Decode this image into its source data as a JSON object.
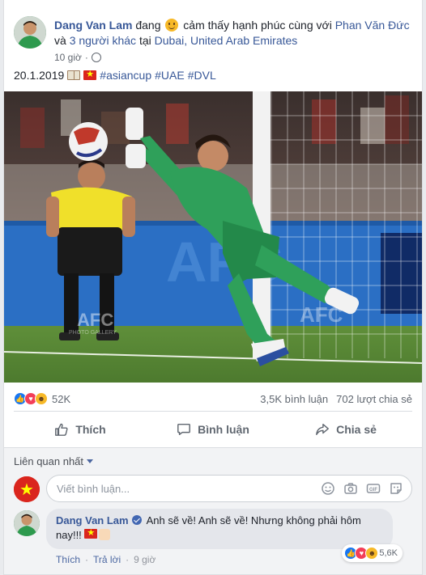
{
  "post": {
    "author": "Dang Van Lam",
    "feeling_prefix": "đang",
    "feeling_text": "cảm thấy hạnh phúc cùng với",
    "tagged_friend": "Phan Văn Đức",
    "and_text": "và",
    "others_link": "3 người khác",
    "at_text": "tại",
    "location": "Dubai, United Arab Emirates",
    "time": "10 giờ",
    "caption_date": "20.1.2019",
    "hashtags": [
      "#asiancup",
      "#UAE",
      "#DVL"
    ],
    "photo_watermark": "AFC",
    "photo_watermark_sub": "PHOTO GALLERY"
  },
  "stats": {
    "reactions_count": "52K",
    "comments_count": "3,5K bình luận",
    "shares_count": "702 lượt chia sẻ"
  },
  "actions": {
    "like": "Thích",
    "comment": "Bình luận",
    "share": "Chia sẻ"
  },
  "comments": {
    "sort_label": "Liên quan nhất",
    "input_placeholder": "Viết bình luận...",
    "input_icons": [
      "emoji-icon",
      "camera-icon",
      "gif-icon",
      "sticker-icon"
    ],
    "items": [
      {
        "author": "Dang Van Lam",
        "text": "Anh sẽ về! Anh sẽ về! Nhưng không phải hôm nay!!!",
        "like_label": "Thích",
        "reply_label": "Trả lời",
        "time": "9 giờ",
        "reactions_count": "5,6K"
      }
    ]
  },
  "colors": {
    "link": "#385898",
    "like_blue": "#1877f2",
    "love_red": "#f33e58",
    "haha_yellow": "#f7b928",
    "keeper_green": "#2fa05a",
    "referee_yellow": "#f0e02a"
  }
}
